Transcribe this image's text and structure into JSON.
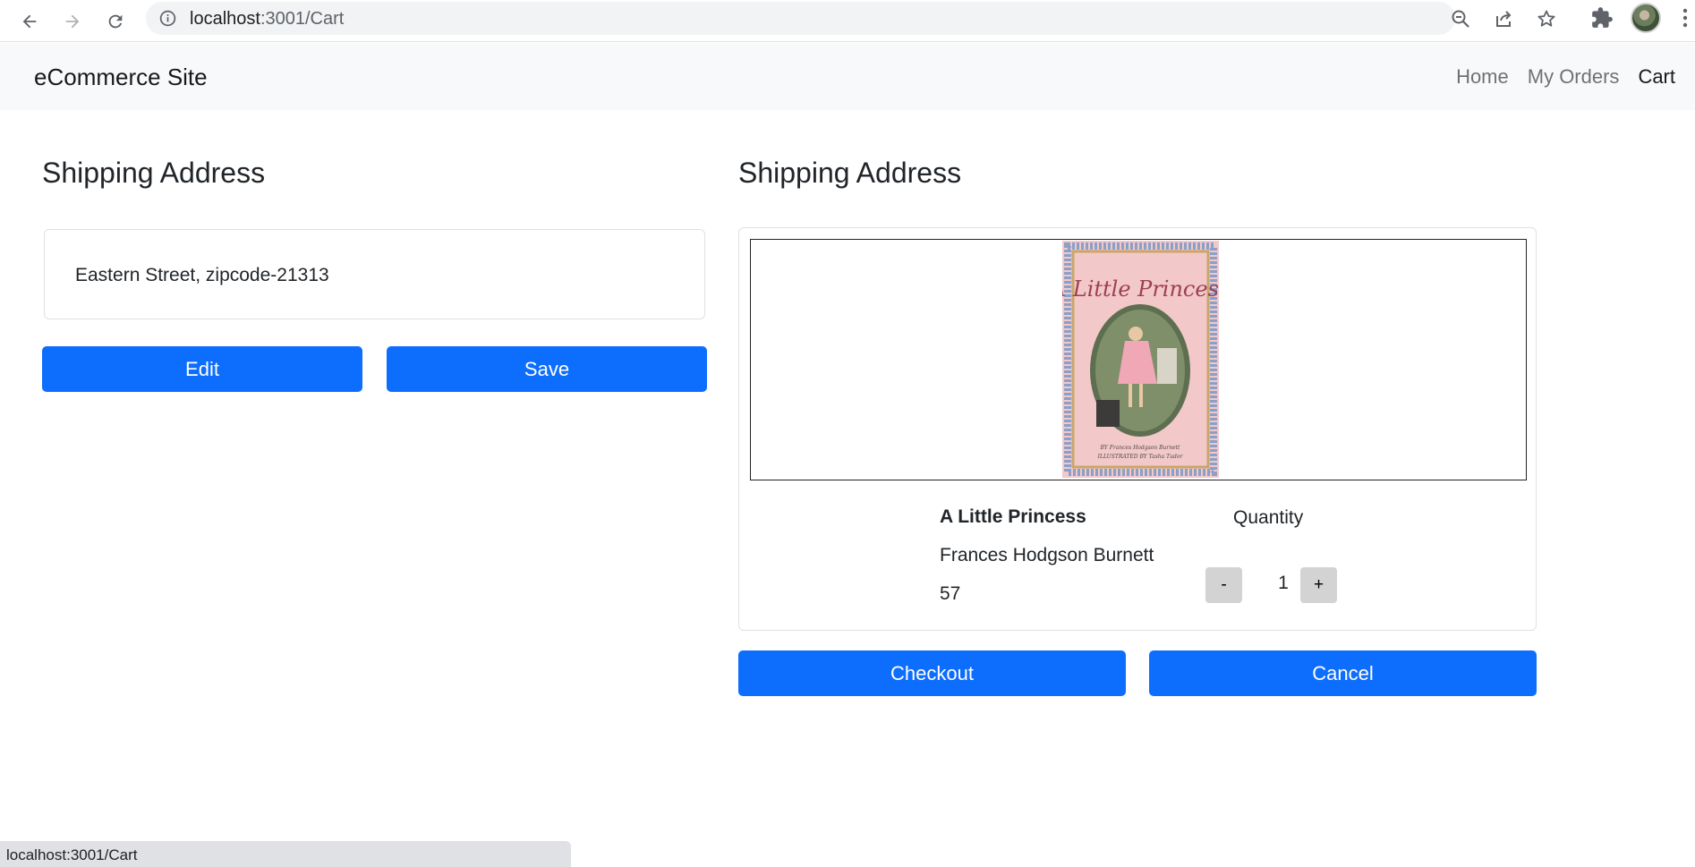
{
  "browser": {
    "url_host": "localhost",
    "url_path": ":3001/Cart",
    "status_text": "localhost:3001/Cart"
  },
  "site": {
    "brand": "eCommerce Site",
    "nav": [
      {
        "label": "Home"
      },
      {
        "label": "My Orders"
      },
      {
        "label": "Cart"
      }
    ]
  },
  "shipping": {
    "heading": "Shipping Address",
    "address": "Eastern Street, zipcode-21313",
    "edit_label": "Edit",
    "save_label": "Save"
  },
  "cart": {
    "heading": "Shipping Address",
    "item": {
      "title": "A Little Princess",
      "author": "Frances Hodgson Burnett",
      "price": "57",
      "cover_title": "A Little Princess",
      "cover_credit_author": "BY Frances Hodgson Burnett",
      "cover_credit_illustrator": "ILLUSTRATED BY Tasha Tudor"
    },
    "quantity_label": "Quantity",
    "quantity": "1",
    "decrement_label": "-",
    "increment_label": "+",
    "checkout_label": "Checkout",
    "cancel_label": "Cancel"
  },
  "colors": {
    "primary": "#0d6efd",
    "navbar_bg": "#f8f9fa",
    "qty_button_bg": "#d3d3d3"
  },
  "icons": [
    "back-arrow-icon",
    "forward-arrow-icon",
    "reload-icon",
    "info-icon",
    "zoom-out-icon",
    "share-icon",
    "star-icon",
    "extensions-icon",
    "menu-dots-icon"
  ]
}
